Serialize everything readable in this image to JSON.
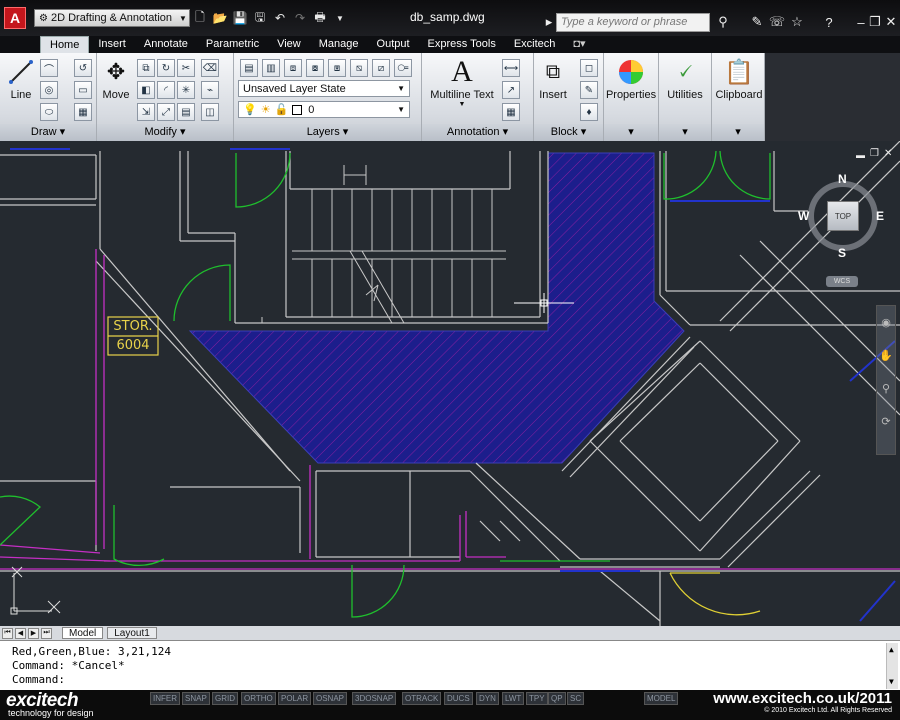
{
  "title_bar": {
    "workspace": "2D Drafting & Annotation",
    "document": "db_samp.dwg",
    "search_placeholder": "Type a keyword or phrase"
  },
  "ribbon_tabs": [
    "Home",
    "Insert",
    "Annotate",
    "Parametric",
    "View",
    "Manage",
    "Output",
    "Express Tools",
    "Excitech"
  ],
  "ribbon": {
    "draw": {
      "title": "Draw",
      "line": "Line"
    },
    "modify": {
      "title": "Modify",
      "move": "Move"
    },
    "layers": {
      "title": "Layers",
      "layer_state": "Unsaved Layer State",
      "current_layer": "0"
    },
    "annotation": {
      "title": "Annotation",
      "multiline_text": "Multiline Text"
    },
    "block": {
      "title": "Block",
      "insert": "Insert"
    },
    "properties": {
      "label": "Properties"
    },
    "utilities": {
      "label": "Utilities"
    },
    "clipboard": {
      "label": "Clipboard"
    }
  },
  "drawing": {
    "room_name": "STOR.",
    "room_number": "6004"
  },
  "viewcube": {
    "north": "N",
    "south": "S",
    "east": "E",
    "west": "W",
    "face": "TOP",
    "ucs": "WCS"
  },
  "layout_tabs": [
    "Model",
    "Layout1"
  ],
  "command_lines": [
    "Red,Green,Blue: 3,21,124",
    "Command: *Cancel*",
    "Command:"
  ],
  "status_buttons": [
    "INFER",
    "SNAP",
    "GRID",
    "ORTHO",
    "POLAR",
    "OSNAP",
    "3DOSNAP",
    "OTRACK",
    "DUCS",
    "DYN",
    "LWT",
    "TPY",
    "QP",
    "SC"
  ],
  "status_right": "MODEL",
  "branding": {
    "name": "excitech",
    "tagline": "technology for design",
    "url": "www.excitech.co.uk/2011",
    "copyright": "© 2010 Excitech Ltd. All Rights Reserved"
  },
  "colors": {
    "canvas": "#252a30",
    "hatch": "#1c1e8c",
    "hatch_line": "#8a1ea0",
    "walls": "#d0d0d0",
    "doors": "#1fbf2d",
    "magenta": "#c42fc4",
    "tag": "#e8d24a"
  }
}
